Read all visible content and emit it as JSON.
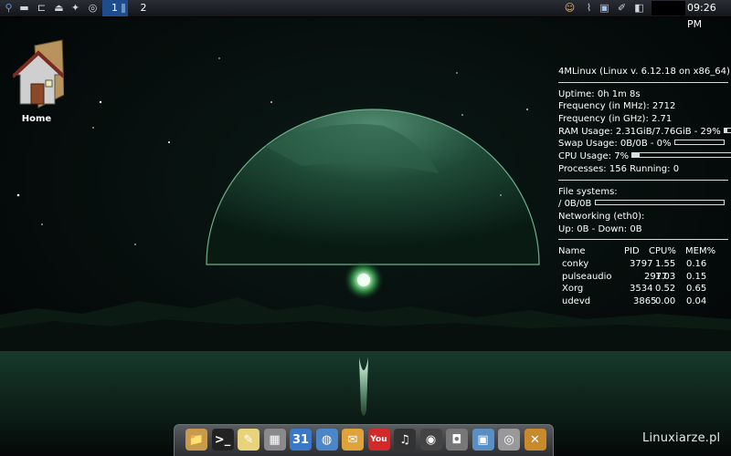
{
  "panel": {
    "workspaces": [
      "1",
      "2"
    ],
    "clock": "09:26 PM",
    "left_icons": [
      "app-menu-icon",
      "drive-icon",
      "usb-drive-icon",
      "eject-icon",
      "paint-icon",
      "disc-icon"
    ],
    "right_icons": [
      "user-icon",
      "paperclip-icon",
      "network-icon",
      "pen-icon",
      "volume-icon"
    ]
  },
  "desktop": {
    "home_label": "Home"
  },
  "conky": {
    "title": "4MLinux (Linux v. 6.12.18 on x86_64)",
    "uptime_label": "Uptime:",
    "uptime": "0h 1m 8s",
    "freq_mhz_label": "Frequency (in MHz):",
    "freq_mhz": "2712",
    "freq_ghz_label": "Frequency (in GHz):",
    "freq_ghz": "2.71",
    "ram_label": "RAM Usage:",
    "ram": "2.31GiB/7.76GiB - 29%",
    "ram_pct": 29,
    "swap_label": "Swap Usage:",
    "swap": "0B/0B - 0%",
    "swap_pct": 0,
    "cpu_label": "CPU Usage:",
    "cpu": "7%",
    "cpu_pct": 7,
    "processes_label": "Processes:",
    "processes": "156",
    "running_label": "Running:",
    "running": "0",
    "fs_label": "File systems:",
    "fs_mount": "/",
    "fs_value": "0B/0B",
    "fs_pct": 0,
    "net_label": "Networking (eth0):",
    "up_label": "Up:",
    "up": "0B",
    "down_label": "- Down:",
    "down": "0B",
    "proc_headers": [
      "Name",
      "PID",
      "CPU%",
      "MEM%"
    ],
    "processes_table": [
      {
        "name": "conky",
        "pid": "3797",
        "cpu": "1.55",
        "mem": "0.16"
      },
      {
        "name": "pulseaudio",
        "pid": "2977",
        "cpu": "1.03",
        "mem": "0.15"
      },
      {
        "name": "Xorg",
        "pid": "3534",
        "cpu": "0.52",
        "mem": "0.65"
      },
      {
        "name": "udevd",
        "pid": "3865",
        "cpu": "0.00",
        "mem": "0.04"
      }
    ]
  },
  "dock": {
    "items": [
      {
        "name": "file-manager-icon",
        "glyph": "📁",
        "color": "#c99a4b"
      },
      {
        "name": "terminal-icon",
        "glyph": ">_",
        "color": "#222222"
      },
      {
        "name": "text-editor-icon",
        "glyph": "✎",
        "color": "#e8d27a"
      },
      {
        "name": "calculator-icon",
        "glyph": "▦",
        "color": "#8a8a8a"
      },
      {
        "name": "calendar-icon",
        "glyph": "31",
        "color": "#3a79c9"
      },
      {
        "name": "web-browser-icon",
        "glyph": "◍",
        "color": "#4a86c8"
      },
      {
        "name": "mail-icon",
        "glyph": "✉",
        "color": "#e0a23a"
      },
      {
        "name": "youtube-icon",
        "glyph": "You",
        "color": "#d22a2a"
      },
      {
        "name": "headphones-icon",
        "glyph": "♫",
        "color": "#333333"
      },
      {
        "name": "video-player-icon",
        "glyph": "◉",
        "color": "#444444"
      },
      {
        "name": "camera-icon",
        "glyph": "◘",
        "color": "#777777"
      },
      {
        "name": "photo-viewer-icon",
        "glyph": "▣",
        "color": "#5a8fc4"
      },
      {
        "name": "webcam-icon",
        "glyph": "◎",
        "color": "#999999"
      },
      {
        "name": "settings-tools-icon",
        "glyph": "✕",
        "color": "#c98a2b"
      }
    ]
  },
  "watermark": "Linuxiarze.pl"
}
